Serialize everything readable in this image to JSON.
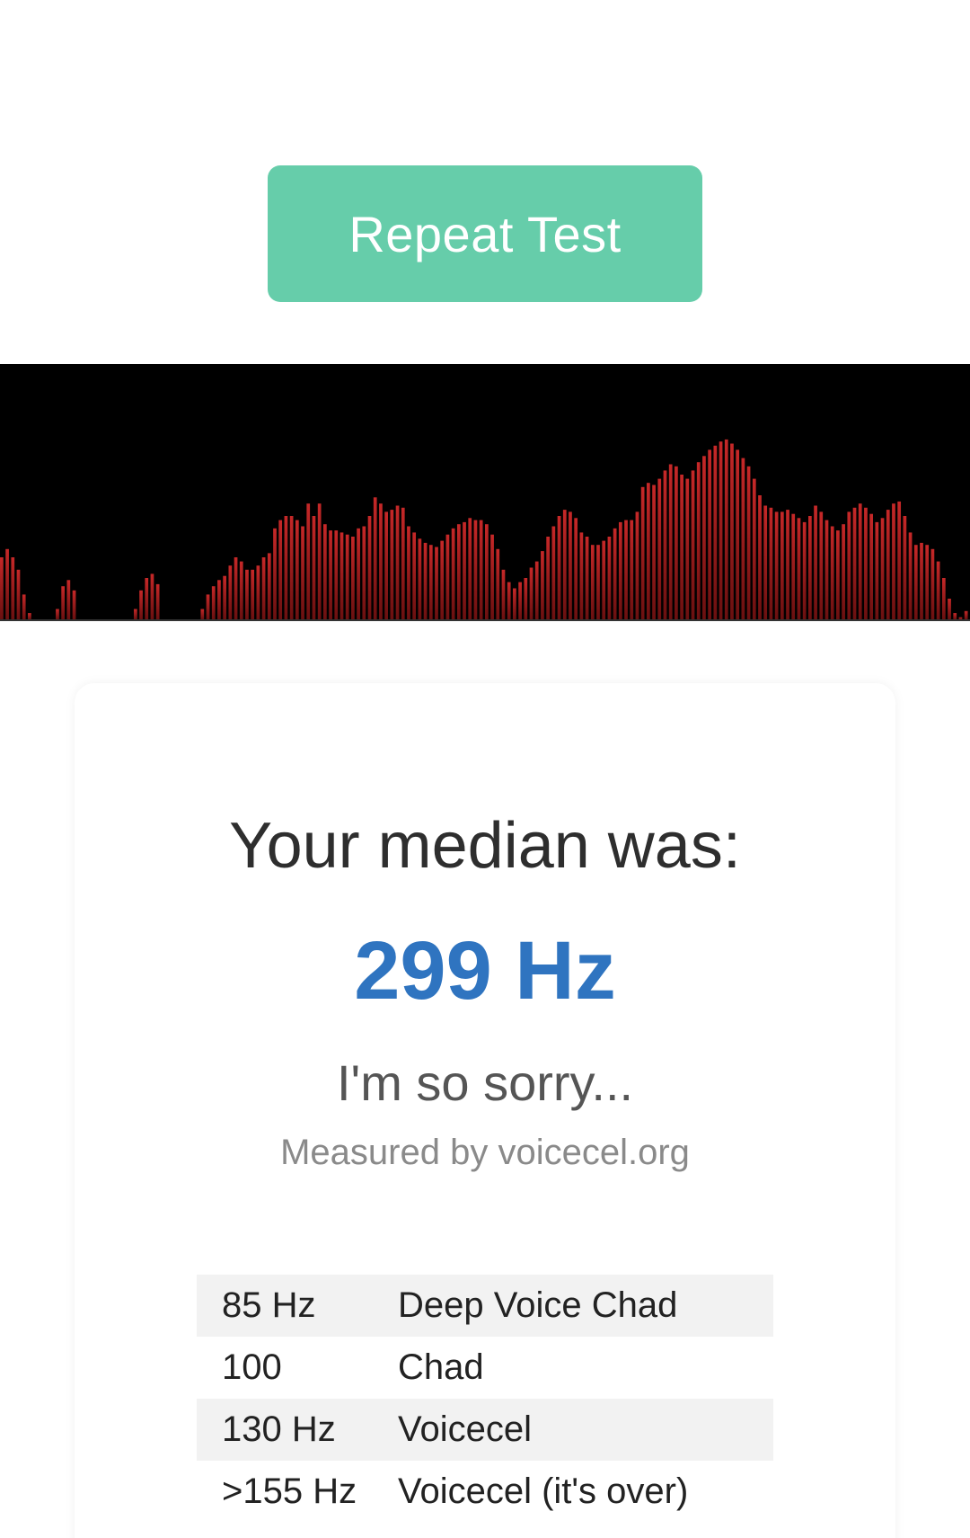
{
  "repeat_button": {
    "label": "Repeat Test",
    "color": "#66cdaa"
  },
  "visualizer": {
    "background": "#000000",
    "bar_color": "#c62828",
    "levels": [
      0.3,
      0.34,
      0.3,
      0.24,
      0.12,
      0.03,
      0,
      0,
      0,
      0,
      0.05,
      0.16,
      0.19,
      0.14,
      0,
      0,
      0,
      0,
      0,
      0,
      0,
      0,
      0,
      0,
      0.05,
      0.14,
      0.2,
      0.22,
      0.17,
      0,
      0,
      0,
      0,
      0,
      0,
      0,
      0.05,
      0.12,
      0.16,
      0.19,
      0.21,
      0.26,
      0.3,
      0.28,
      0.24,
      0.24,
      0.26,
      0.3,
      0.32,
      0.44,
      0.48,
      0.5,
      0.5,
      0.48,
      0.45,
      0.56,
      0.5,
      0.56,
      0.46,
      0.43,
      0.43,
      0.42,
      0.41,
      0.4,
      0.44,
      0.45,
      0.5,
      0.59,
      0.56,
      0.52,
      0.53,
      0.55,
      0.54,
      0.45,
      0.42,
      0.39,
      0.37,
      0.36,
      0.35,
      0.38,
      0.41,
      0.44,
      0.46,
      0.47,
      0.49,
      0.48,
      0.48,
      0.46,
      0.41,
      0.34,
      0.24,
      0.18,
      0.15,
      0.18,
      0.2,
      0.25,
      0.28,
      0.33,
      0.4,
      0.45,
      0.5,
      0.53,
      0.52,
      0.49,
      0.42,
      0.4,
      0.36,
      0.36,
      0.38,
      0.4,
      0.44,
      0.47,
      0.48,
      0.48,
      0.52,
      0.64,
      0.66,
      0.65,
      0.68,
      0.72,
      0.75,
      0.74,
      0.7,
      0.68,
      0.72,
      0.76,
      0.79,
      0.82,
      0.84,
      0.86,
      0.87,
      0.85,
      0.82,
      0.78,
      0.74,
      0.68,
      0.6,
      0.55,
      0.54,
      0.52,
      0.52,
      0.53,
      0.51,
      0.49,
      0.47,
      0.5,
      0.55,
      0.52,
      0.48,
      0.45,
      0.43,
      0.46,
      0.52,
      0.54,
      0.56,
      0.54,
      0.51,
      0.47,
      0.49,
      0.53,
      0.56,
      0.57,
      0.5,
      0.42,
      0.36,
      0.37,
      0.36,
      0.34,
      0.28,
      0.2,
      0.1,
      0.03,
      0.01,
      0.04
    ]
  },
  "result": {
    "median_label": "Your median was:",
    "median_value": "299 Hz",
    "verdict": "I'm so sorry...",
    "credit": "Measured by voicecel.org",
    "value_color": "#2f74c0"
  },
  "scale": {
    "rows": [
      {
        "hz": "85 Hz",
        "label": "Deep Voice Chad"
      },
      {
        "hz": "100",
        "label": "Chad"
      },
      {
        "hz": "130 Hz",
        "label": "Voicecel"
      },
      {
        "hz": ">155 Hz",
        "label": "Voicecel (it's over)"
      }
    ]
  }
}
